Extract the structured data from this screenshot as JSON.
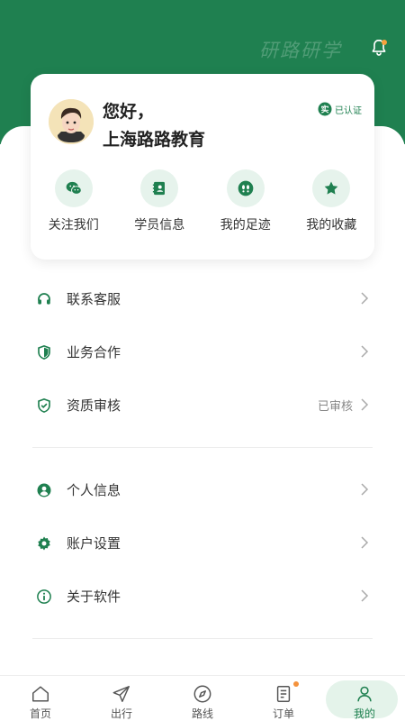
{
  "header": {
    "brand": "研路研学"
  },
  "profile": {
    "greeting": "您好，",
    "org_name": "上海路路教育",
    "verified_label": "已认证"
  },
  "quick_actions": [
    {
      "label": "关注我们",
      "icon": "wechat-icon"
    },
    {
      "label": "学员信息",
      "icon": "contact-book-icon"
    },
    {
      "label": "我的足迹",
      "icon": "footprints-icon"
    },
    {
      "label": "我的收藏",
      "icon": "star-icon"
    }
  ],
  "menu_group_1": [
    {
      "label": "联系客服",
      "icon": "headset-icon",
      "value": ""
    },
    {
      "label": "业务合作",
      "icon": "shield-icon",
      "value": ""
    },
    {
      "label": "资质审核",
      "icon": "shield-check-icon",
      "value": "已审核"
    }
  ],
  "menu_group_2": [
    {
      "label": "个人信息",
      "icon": "user-circle-icon"
    },
    {
      "label": "账户设置",
      "icon": "gear-icon"
    },
    {
      "label": "关于软件",
      "icon": "info-icon"
    }
  ],
  "tabbar": [
    {
      "label": "首页",
      "icon": "home-icon"
    },
    {
      "label": "出行",
      "icon": "paper-plane-icon"
    },
    {
      "label": "路线",
      "icon": "compass-icon"
    },
    {
      "label": "订单",
      "icon": "order-icon"
    },
    {
      "label": "我的",
      "icon": "person-icon",
      "active": true
    }
  ],
  "colors": {
    "primary": "#1f8050",
    "accent": "#f4a23d",
    "light_green": "#e6f3ec"
  }
}
